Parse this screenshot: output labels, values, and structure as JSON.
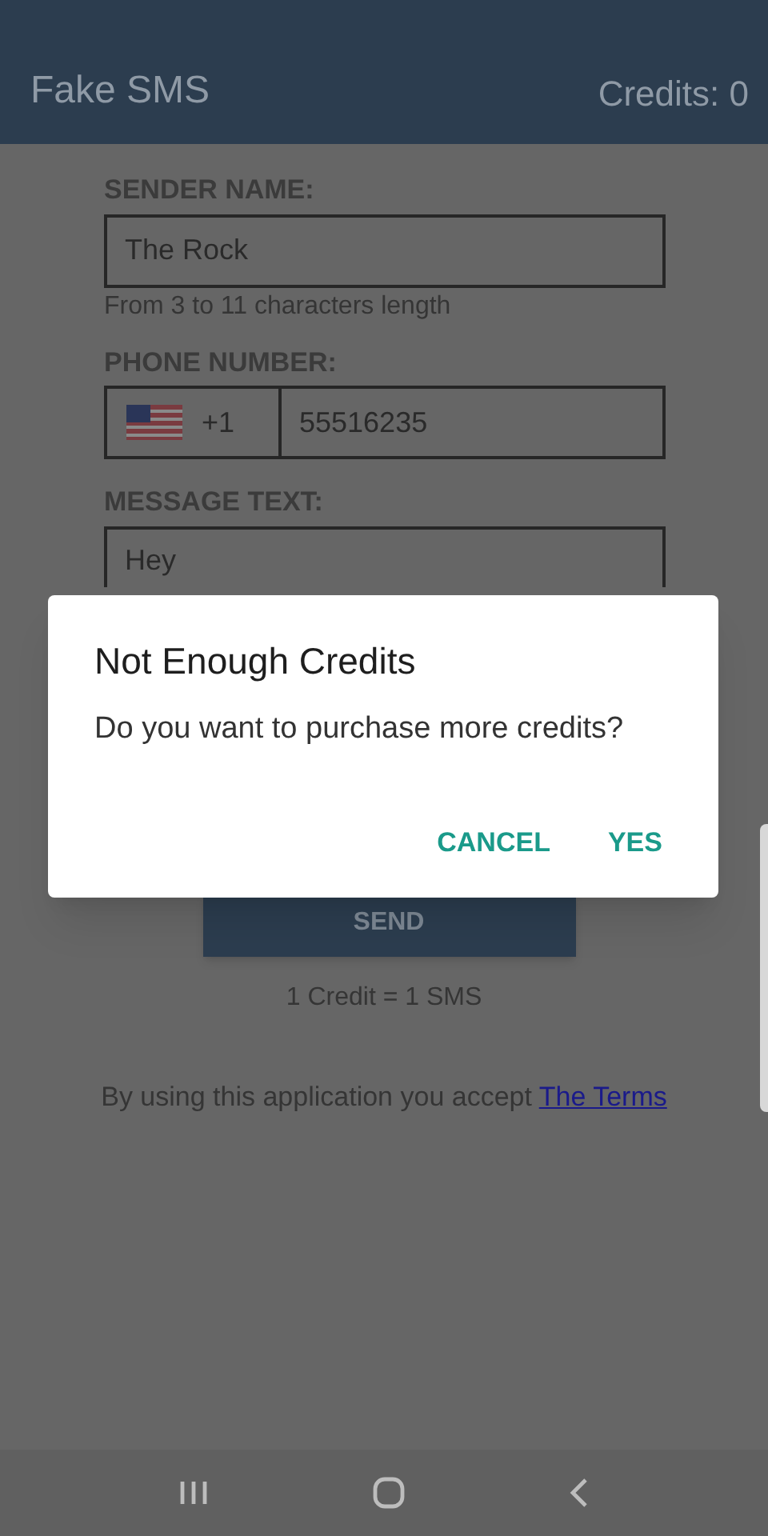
{
  "app_bar": {
    "title": "Fake SMS",
    "credits": "Credits: 0"
  },
  "form": {
    "sender_label": "SENDER NAME:",
    "sender_value": "The Rock",
    "sender_hint": "From 3 to 11 characters length",
    "phone_label": "PHONE NUMBER:",
    "country_code": "+1",
    "phone_value": "55516235",
    "message_label": "MESSAGE TEXT:",
    "message_value": "Hey"
  },
  "send_button": "SEND",
  "credit_note": "1 Credit = 1 SMS",
  "terms": {
    "text": "By using this application you accept",
    "link": "The Terms"
  },
  "dialog": {
    "title": "Not Enough Credits",
    "message": "Do you want to purchase more credits?",
    "buttons": [
      "CANCEL",
      "YES"
    ]
  }
}
